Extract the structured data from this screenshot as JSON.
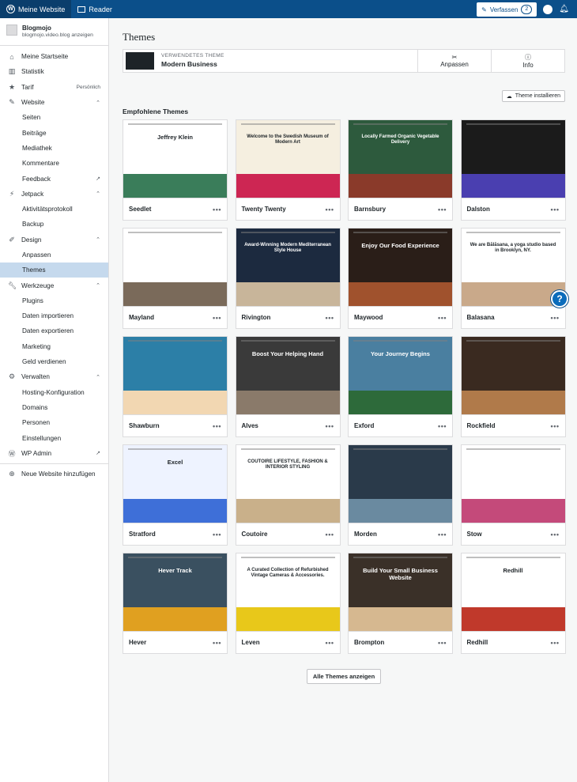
{
  "topbar": {
    "my_site": "Meine Website",
    "reader": "Reader",
    "write": "Verfassen",
    "write_count": "2"
  },
  "site": {
    "name": "Blogmojo",
    "url": "blogmojo.video.blog anzeigen"
  },
  "nav": {
    "home": "Meine Startseite",
    "stats": "Statistik",
    "plan": "Tarif",
    "plan_tag": "Persönlich",
    "website": "Website",
    "pages": "Seiten",
    "posts": "Beiträge",
    "media": "Mediathek",
    "comments": "Kommentare",
    "feedback": "Feedback",
    "jetpack": "Jetpack",
    "activity": "Aktivitätsprotokoll",
    "backup": "Backup",
    "design": "Design",
    "customize": "Anpassen",
    "themes": "Themes",
    "tools": "Werkzeuge",
    "plugins": "Plugins",
    "import": "Daten importieren",
    "export": "Daten exportieren",
    "marketing": "Marketing",
    "earn": "Geld verdienen",
    "manage": "Verwalten",
    "hosting": "Hosting-Konfiguration",
    "domains": "Domains",
    "people": "Personen",
    "settings": "Einstellungen",
    "wp_admin": "WP Admin",
    "add_site": "Neue Website hinzufügen"
  },
  "main": {
    "title": "Themes",
    "current_label": "VERWENDETES THEME",
    "current_name": "Modern Business",
    "customize": "Anpassen",
    "info": "Info",
    "install": "Theme installieren",
    "recommended": "Empfohlene Themes",
    "all_themes": "Alle Themes anzeigen"
  },
  "themes": [
    {
      "name": "Seedlet",
      "headline": "Jeffrey Klein",
      "bg": "#ffffff",
      "accent": "#3a7d5a"
    },
    {
      "name": "Twenty Twenty",
      "headline": "Welcome to the Swedish Museum of Modern Art",
      "bg": "#f5efe0",
      "accent": "#cd2653"
    },
    {
      "name": "Barnsbury",
      "headline": "Locally Farmed Organic Vegetable Delivery",
      "bg": "#2d5a3d",
      "accent": "#8a3a2a"
    },
    {
      "name": "Dalston",
      "headline": "",
      "bg": "#1b1b1b",
      "accent": "#4a3fb0"
    },
    {
      "name": "Mayland",
      "headline": "",
      "bg": "#ffffff",
      "accent": "#7a6a5a"
    },
    {
      "name": "Rivington",
      "headline": "Award-Winning Modern Mediterranean Style House",
      "bg": "#1c2a3f",
      "accent": "#c8b59a"
    },
    {
      "name": "Maywood",
      "headline": "Enjoy Our Food Experience",
      "bg": "#2a1e18",
      "accent": "#a0522d"
    },
    {
      "name": "Balasana",
      "headline": "We are Bālāsana, a yoga studio based in Brooklyn, NY.",
      "bg": "#ffffff",
      "accent": "#c9a98a"
    },
    {
      "name": "Shawburn",
      "headline": "",
      "bg": "#2c7fa7",
      "accent": "#f2d7b2"
    },
    {
      "name": "Alves",
      "headline": "Boost Your Helping Hand",
      "bg": "#3a3a3a",
      "accent": "#8a7a6a"
    },
    {
      "name": "Exford",
      "headline": "Your Journey Begins",
      "bg": "#4a7fa0",
      "accent": "#2d6a3a"
    },
    {
      "name": "Rockfield",
      "headline": "",
      "bg": "#3a2a20",
      "accent": "#b07a4a"
    },
    {
      "name": "Stratford",
      "headline": "Excel",
      "bg": "#eef3ff",
      "accent": "#3e6fd8"
    },
    {
      "name": "Coutoire",
      "headline": "COUTOIRE LIFESTYLE, FASHION & INTERIOR STYLING",
      "bg": "#ffffff",
      "accent": "#c9b08a"
    },
    {
      "name": "Morden",
      "headline": "",
      "bg": "#2a3a4a",
      "accent": "#6a8aa0"
    },
    {
      "name": "Stow",
      "headline": "",
      "bg": "#ffffff",
      "accent": "#c44a7a"
    },
    {
      "name": "Hever",
      "headline": "Hever Track",
      "bg": "#3a5060",
      "accent": "#e0a020"
    },
    {
      "name": "Leven",
      "headline": "A Curated Collection of Refurbished Vintage Cameras & Accessories.",
      "bg": "#ffffff",
      "accent": "#e8c81a"
    },
    {
      "name": "Brompton",
      "headline": "Build Your Small Business Website",
      "bg": "#3a3028",
      "accent": "#d6b890"
    },
    {
      "name": "Redhill",
      "headline": "Redhill",
      "bg": "#ffffff",
      "accent": "#c0392b"
    }
  ]
}
